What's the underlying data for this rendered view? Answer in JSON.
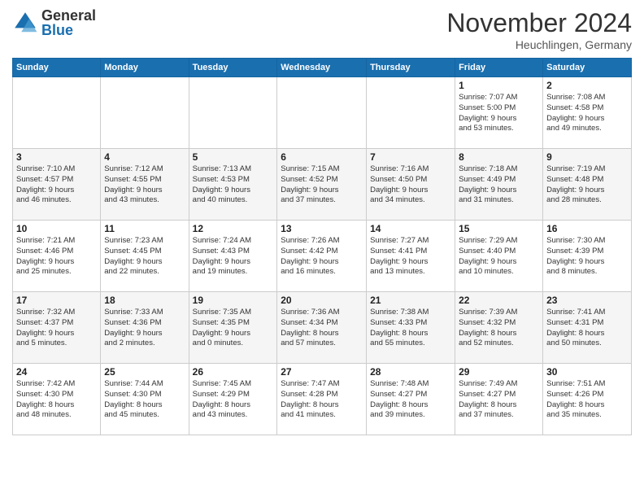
{
  "header": {
    "logo_general": "General",
    "logo_blue": "Blue",
    "month_title": "November 2024",
    "location": "Heuchlingen, Germany"
  },
  "weekdays": [
    "Sunday",
    "Monday",
    "Tuesday",
    "Wednesday",
    "Thursday",
    "Friday",
    "Saturday"
  ],
  "weeks": [
    [
      {
        "day": "",
        "info": ""
      },
      {
        "day": "",
        "info": ""
      },
      {
        "day": "",
        "info": ""
      },
      {
        "day": "",
        "info": ""
      },
      {
        "day": "",
        "info": ""
      },
      {
        "day": "1",
        "info": "Sunrise: 7:07 AM\nSunset: 5:00 PM\nDaylight: 9 hours\nand 53 minutes."
      },
      {
        "day": "2",
        "info": "Sunrise: 7:08 AM\nSunset: 4:58 PM\nDaylight: 9 hours\nand 49 minutes."
      }
    ],
    [
      {
        "day": "3",
        "info": "Sunrise: 7:10 AM\nSunset: 4:57 PM\nDaylight: 9 hours\nand 46 minutes."
      },
      {
        "day": "4",
        "info": "Sunrise: 7:12 AM\nSunset: 4:55 PM\nDaylight: 9 hours\nand 43 minutes."
      },
      {
        "day": "5",
        "info": "Sunrise: 7:13 AM\nSunset: 4:53 PM\nDaylight: 9 hours\nand 40 minutes."
      },
      {
        "day": "6",
        "info": "Sunrise: 7:15 AM\nSunset: 4:52 PM\nDaylight: 9 hours\nand 37 minutes."
      },
      {
        "day": "7",
        "info": "Sunrise: 7:16 AM\nSunset: 4:50 PM\nDaylight: 9 hours\nand 34 minutes."
      },
      {
        "day": "8",
        "info": "Sunrise: 7:18 AM\nSunset: 4:49 PM\nDaylight: 9 hours\nand 31 minutes."
      },
      {
        "day": "9",
        "info": "Sunrise: 7:19 AM\nSunset: 4:48 PM\nDaylight: 9 hours\nand 28 minutes."
      }
    ],
    [
      {
        "day": "10",
        "info": "Sunrise: 7:21 AM\nSunset: 4:46 PM\nDaylight: 9 hours\nand 25 minutes."
      },
      {
        "day": "11",
        "info": "Sunrise: 7:23 AM\nSunset: 4:45 PM\nDaylight: 9 hours\nand 22 minutes."
      },
      {
        "day": "12",
        "info": "Sunrise: 7:24 AM\nSunset: 4:43 PM\nDaylight: 9 hours\nand 19 minutes."
      },
      {
        "day": "13",
        "info": "Sunrise: 7:26 AM\nSunset: 4:42 PM\nDaylight: 9 hours\nand 16 minutes."
      },
      {
        "day": "14",
        "info": "Sunrise: 7:27 AM\nSunset: 4:41 PM\nDaylight: 9 hours\nand 13 minutes."
      },
      {
        "day": "15",
        "info": "Sunrise: 7:29 AM\nSunset: 4:40 PM\nDaylight: 9 hours\nand 10 minutes."
      },
      {
        "day": "16",
        "info": "Sunrise: 7:30 AM\nSunset: 4:39 PM\nDaylight: 9 hours\nand 8 minutes."
      }
    ],
    [
      {
        "day": "17",
        "info": "Sunrise: 7:32 AM\nSunset: 4:37 PM\nDaylight: 9 hours\nand 5 minutes."
      },
      {
        "day": "18",
        "info": "Sunrise: 7:33 AM\nSunset: 4:36 PM\nDaylight: 9 hours\nand 2 minutes."
      },
      {
        "day": "19",
        "info": "Sunrise: 7:35 AM\nSunset: 4:35 PM\nDaylight: 9 hours\nand 0 minutes."
      },
      {
        "day": "20",
        "info": "Sunrise: 7:36 AM\nSunset: 4:34 PM\nDaylight: 8 hours\nand 57 minutes."
      },
      {
        "day": "21",
        "info": "Sunrise: 7:38 AM\nSunset: 4:33 PM\nDaylight: 8 hours\nand 55 minutes."
      },
      {
        "day": "22",
        "info": "Sunrise: 7:39 AM\nSunset: 4:32 PM\nDaylight: 8 hours\nand 52 minutes."
      },
      {
        "day": "23",
        "info": "Sunrise: 7:41 AM\nSunset: 4:31 PM\nDaylight: 8 hours\nand 50 minutes."
      }
    ],
    [
      {
        "day": "24",
        "info": "Sunrise: 7:42 AM\nSunset: 4:30 PM\nDaylight: 8 hours\nand 48 minutes."
      },
      {
        "day": "25",
        "info": "Sunrise: 7:44 AM\nSunset: 4:30 PM\nDaylight: 8 hours\nand 45 minutes."
      },
      {
        "day": "26",
        "info": "Sunrise: 7:45 AM\nSunset: 4:29 PM\nDaylight: 8 hours\nand 43 minutes."
      },
      {
        "day": "27",
        "info": "Sunrise: 7:47 AM\nSunset: 4:28 PM\nDaylight: 8 hours\nand 41 minutes."
      },
      {
        "day": "28",
        "info": "Sunrise: 7:48 AM\nSunset: 4:27 PM\nDaylight: 8 hours\nand 39 minutes."
      },
      {
        "day": "29",
        "info": "Sunrise: 7:49 AM\nSunset: 4:27 PM\nDaylight: 8 hours\nand 37 minutes."
      },
      {
        "day": "30",
        "info": "Sunrise: 7:51 AM\nSunset: 4:26 PM\nDaylight: 8 hours\nand 35 minutes."
      }
    ]
  ]
}
